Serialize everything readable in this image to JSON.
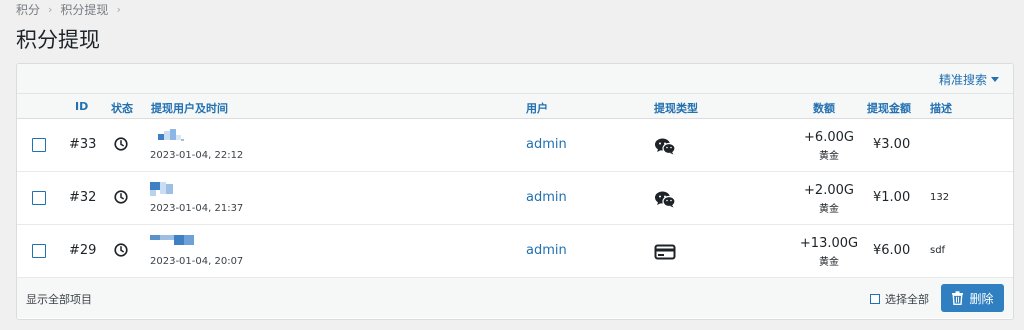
{
  "breadcrumb": {
    "items": [
      "积分",
      "积分提现"
    ],
    "separator": "›"
  },
  "page_title": "积分提现",
  "toolbar": {
    "advanced_search_label": "精准搜索"
  },
  "table": {
    "headers": {
      "id": "ID",
      "status": "状态",
      "user_time": "提现用户及时间",
      "user": "用户",
      "type": "提现类型",
      "amount": "数额",
      "money": "提现金额",
      "desc": "描述"
    },
    "rows": [
      {
        "id": "#33",
        "status_icon": "clock-icon",
        "time": "2023-01-04, 22:12",
        "user": "admin",
        "type_icon": "wechat-icon",
        "amount": "+6.00G",
        "unit": "黄金",
        "money": "¥3.00",
        "desc": ""
      },
      {
        "id": "#32",
        "status_icon": "clock-icon",
        "time": "2023-01-04, 21:37",
        "user": "admin",
        "type_icon": "wechat-icon",
        "amount": "+2.00G",
        "unit": "黄金",
        "money": "¥1.00",
        "desc": "132"
      },
      {
        "id": "#29",
        "status_icon": "clock-icon",
        "time": "2023-01-04, 20:07",
        "user": "admin",
        "type_icon": "card-icon",
        "amount": "+13.00G",
        "unit": "黄金",
        "money": "¥6.00",
        "desc": "sdf"
      }
    ]
  },
  "footer": {
    "show_all_label": "显示全部项目",
    "select_all_label": "选择全部",
    "delete_label": "删除"
  },
  "colors": {
    "accent": "#2271b1",
    "button": "#2f7fc1",
    "background": "#f0f0f1"
  }
}
